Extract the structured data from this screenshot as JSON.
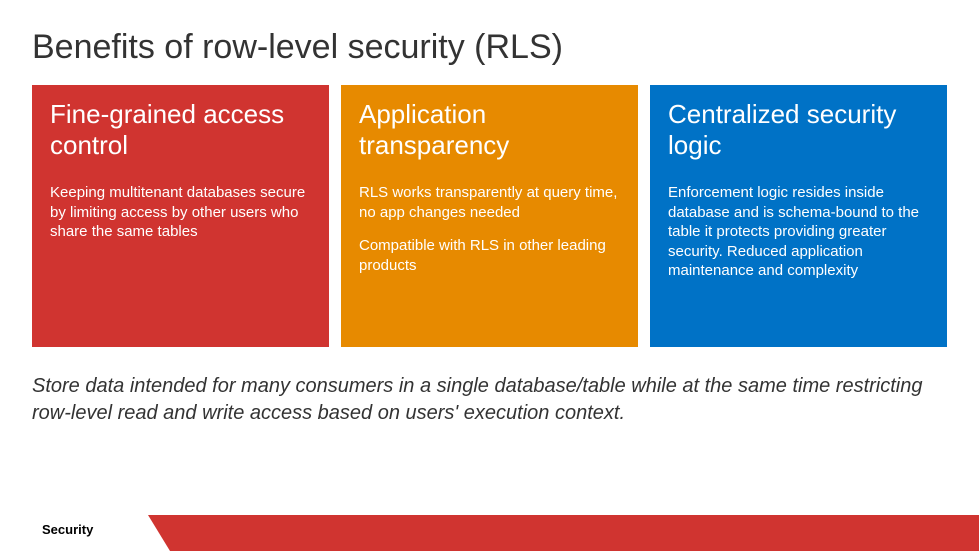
{
  "title": "Benefits of row-level security (RLS)",
  "cards": [
    {
      "heading": "Fine-grained access control",
      "body1": "Keeping multitenant databases secure by limiting access by other users who share the same tables",
      "body2": ""
    },
    {
      "heading": "Application transparency",
      "body1": "RLS works transparently at query time, no app changes needed",
      "body2": "Compatible with RLS in other leading products"
    },
    {
      "heading": "Centralized security logic",
      "body1": "Enforcement logic resides inside database and is schema-bound to the table it protects providing greater security. Reduced application maintenance and complexity",
      "body2": ""
    }
  ],
  "summary": "Store data intended for many consumers in a single database/table while at the same time restricting row-level read and write access based on users' execution context.",
  "footer": "Security",
  "colors": {
    "red": "#d03430",
    "orange": "#e78a00",
    "blue": "#0072c6"
  }
}
